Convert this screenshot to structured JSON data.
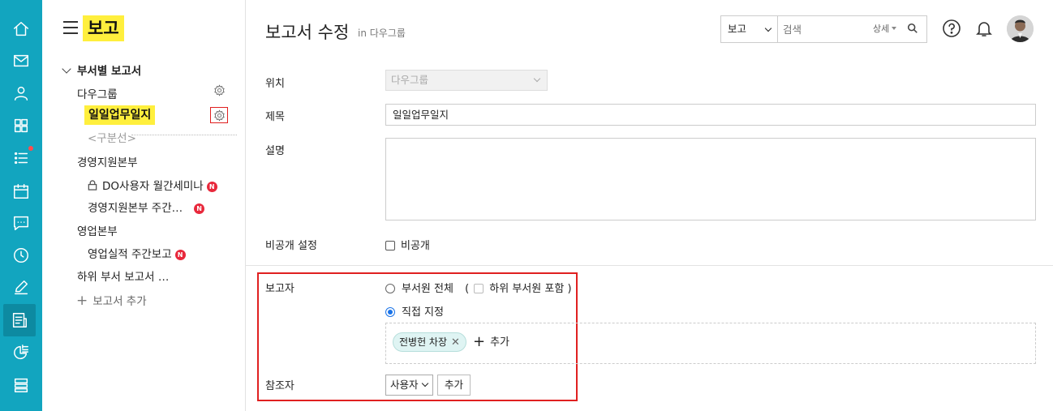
{
  "app": {
    "title": "보고"
  },
  "colors": {
    "rail": "#12a5bf",
    "highlight": "#ffef3d",
    "danger": "#e02020",
    "badge": "#e8283b",
    "radio": "#1a73e8"
  },
  "rail_icons": [
    "home-icon",
    "mail-icon",
    "user-icon",
    "apps-icon",
    "tasks-icon",
    "calendar-icon",
    "chat-icon",
    "clock-icon",
    "edit-icon",
    "report-icon",
    "chart-icon",
    "list-icon"
  ],
  "sidebar": {
    "section_label": "부서별 보고서",
    "tree": [
      {
        "label": "다우그룹"
      },
      {
        "label": "일일업무일지"
      },
      {
        "label": "<구분선>"
      },
      {
        "label": "경영지원본부"
      },
      {
        "label": "DO사용자 월간세미나"
      },
      {
        "label": "경영지원본부 주간…"
      },
      {
        "label": "영업본부"
      },
      {
        "label": "영업실적 주간보고"
      },
      {
        "label": "하위 부서 보고서 …"
      }
    ],
    "badge_text": "N",
    "add_label": "보고서 추가"
  },
  "header": {
    "title": "보고서 수정",
    "subtitle": "in 다우그룹",
    "search": {
      "scope": "보고",
      "placeholder": "검색",
      "detail": "상세"
    }
  },
  "form": {
    "location": {
      "label": "위치",
      "value": "다우그룹"
    },
    "subject": {
      "label": "제목",
      "value": "일일업무일지"
    },
    "description": {
      "label": "설명"
    },
    "privacy": {
      "label": "비공개 설정",
      "checkbox": "비공개"
    },
    "reporter": {
      "label": "보고자",
      "option_all": "부서원 전체",
      "include_sub_prefix": "(",
      "include_sub": "하위 부서원 포함",
      "include_sub_suffix": ")",
      "option_direct": "직접 지정",
      "selected_user": "전병헌 차장",
      "add_label": "추가"
    },
    "reference": {
      "label": "참조자",
      "select_value": "사용자",
      "add_button": "추가"
    }
  }
}
